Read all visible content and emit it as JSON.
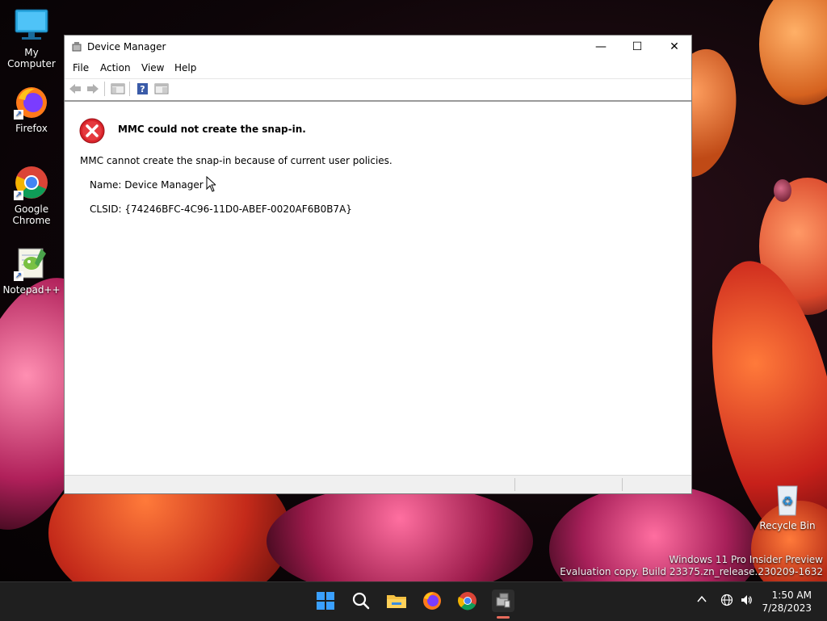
{
  "desktop": {
    "icons": [
      {
        "label": "My Computer"
      },
      {
        "label": "Firefox"
      },
      {
        "label": "Google Chrome"
      },
      {
        "label": "Notepad++"
      },
      {
        "label": "Recycle Bin"
      }
    ],
    "watermark": {
      "line1": "Windows 11 Pro Insider Preview",
      "line2": "Evaluation copy. Build 23375.zn_release.230209-1632"
    }
  },
  "window": {
    "title": "Device Manager",
    "controls": {
      "minimize": "—",
      "maximize": "☐",
      "close": "✕"
    },
    "menu": [
      "File",
      "Action",
      "View",
      "Help"
    ],
    "error": {
      "title": "MMC could not create the snap-in.",
      "message": "MMC cannot create the snap-in because of current user policies.",
      "name": "Name: Device Manager",
      "clsid": "CLSID: {74246BFC-4C96-11D0-ABEF-0020AF6B0B7A}"
    }
  },
  "taskbar": {
    "clock": {
      "time": "1:50 AM",
      "date": "7/28/2023"
    },
    "pinned": [
      "start-icon",
      "search-icon",
      "file-explorer-icon",
      "firefox-icon",
      "chrome-icon",
      "device-manager-icon"
    ]
  },
  "colors": {
    "error_red": "#d8232a",
    "taskbar": "#1f1f1f",
    "accent_indicator": "#e86b5c"
  }
}
